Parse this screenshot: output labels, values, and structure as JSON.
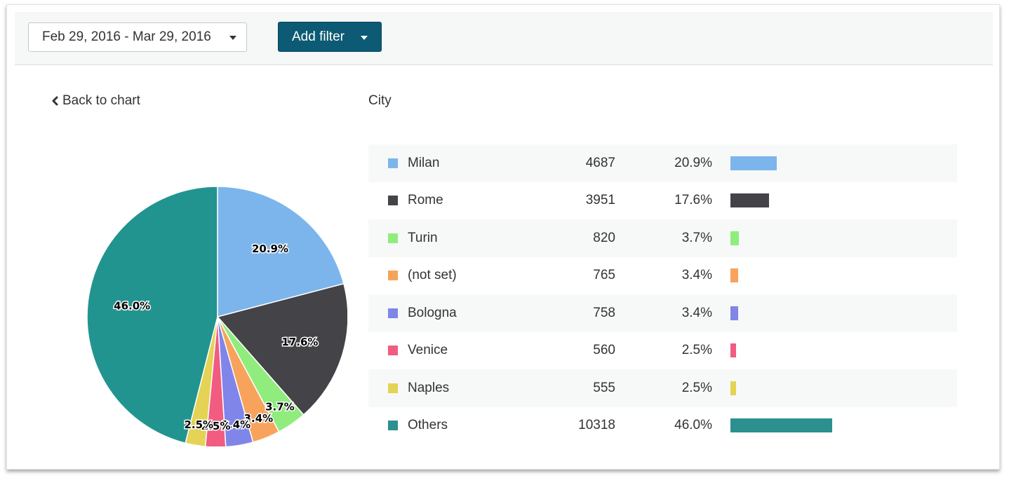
{
  "toolbar": {
    "date_range": "Feb 29, 2016 - Mar 29, 2016",
    "add_filter_label": "Add filter"
  },
  "nav": {
    "back_label": "Back to chart"
  },
  "dimension_title": "City",
  "colors": {
    "accent_button": "#0c5a74"
  },
  "rows": [
    {
      "name": "Milan",
      "count": "4687",
      "percent": "20.9%",
      "share": 0.209,
      "color": "#7cb5ec"
    },
    {
      "name": "Rome",
      "count": "3951",
      "percent": "17.6%",
      "share": 0.176,
      "color": "#434348"
    },
    {
      "name": "Turin",
      "count": "820",
      "percent": "3.7%",
      "share": 0.037,
      "color": "#90ed7d"
    },
    {
      "name": "(not set)",
      "count": "765",
      "percent": "3.4%",
      "share": 0.034,
      "color": "#f7a35c"
    },
    {
      "name": "Bologna",
      "count": "758",
      "percent": "3.4%",
      "share": 0.034,
      "color": "#8085e9"
    },
    {
      "name": "Venice",
      "count": "560",
      "percent": "2.5%",
      "share": 0.025,
      "color": "#f15c80"
    },
    {
      "name": "Naples",
      "count": "555",
      "percent": "2.5%",
      "share": 0.025,
      "color": "#e4d354"
    },
    {
      "name": "Others",
      "count": "10318",
      "percent": "46.0%",
      "share": 0.46,
      "color": "#2b908f"
    }
  ],
  "chart_data": {
    "type": "pie",
    "categories": [
      "Milan",
      "Rome",
      "Turin",
      "(not set)",
      "Bologna",
      "Venice",
      "Naples",
      "Others"
    ],
    "values": [
      4687,
      3951,
      820,
      765,
      758,
      560,
      555,
      10318
    ],
    "labels": [
      "20.9%",
      "17.6%",
      "3.7%",
      "3.4%",
      "3.4%",
      "2.5%",
      "2.5%",
      "46.0%"
    ],
    "colors": [
      "#7cb5ec",
      "#434348",
      "#90ed7d",
      "#f7a35c",
      "#8085e9",
      "#f15c80",
      "#e4d354",
      "#229490"
    ],
    "start_angle": "12 o'clock, clockwise"
  }
}
